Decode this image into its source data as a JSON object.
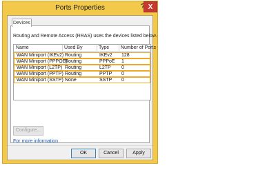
{
  "window": {
    "title": "Ports Properties",
    "help_label": "?",
    "close_label": "X"
  },
  "tabs": [
    {
      "label": "Devices"
    }
  ],
  "description": "Routing and Remote Access (RRAS) uses the devices listed below.",
  "table": {
    "columns": [
      "Name",
      "Used By",
      "Type",
      "Number of Ports"
    ],
    "rows": [
      [
        "WAN Miniport (IKEv2)",
        "Routing",
        "IKEv2",
        "128"
      ],
      [
        "WAN Miniport (PPPOE)",
        "Routing",
        "PPPoE",
        "1"
      ],
      [
        "WAN Miniport (L2TP)",
        "Routing",
        "L2TP",
        "0"
      ],
      [
        "WAN Miniport (PPTP)",
        "Routing",
        "PPTP",
        "0"
      ],
      [
        "WAN Miniport (SSTP)",
        "None",
        "SSTP",
        "0"
      ]
    ]
  },
  "configure_label": "Configure...",
  "more_info_label": "For more information",
  "buttons": {
    "ok": "OK",
    "cancel": "Cancel",
    "apply": "Apply"
  },
  "colors": {
    "window_frame": "#f2c94a",
    "row_highlight": "#eea828",
    "close_button": "#c7392f"
  }
}
